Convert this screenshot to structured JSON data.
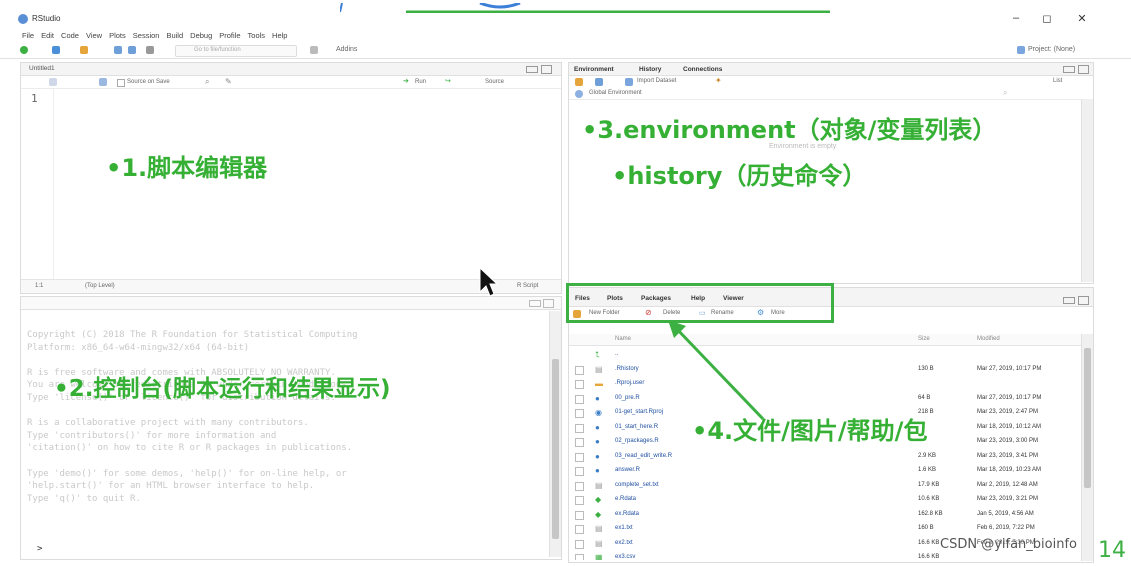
{
  "window": {
    "title": "RStudio",
    "controls": [
      "–",
      "◻",
      "✕"
    ]
  },
  "menu": [
    "File",
    "Edit",
    "Code",
    "View",
    "Plots",
    "Session",
    "Build",
    "Debug",
    "Profile",
    "Tools",
    "Help"
  ],
  "toolbar": {
    "goto_placeholder": "Go to file/function",
    "addins_label": "Addins",
    "project_label": "Project: (None)"
  },
  "editor": {
    "tab_label": "Untitled1",
    "source_on_save": "Source on Save",
    "run_label": "Run",
    "source_label": "Source",
    "line_number": "1",
    "status_pos": "1:1",
    "status_level": "(Top Level)",
    "status_type": "R Script"
  },
  "console": {
    "lines": [
      "Copyright (C) 2018 The R Foundation for Statistical Computing",
      "Platform: x86_64-w64-mingw32/x64 (64-bit)",
      "",
      "R is free software and comes with ABSOLUTELY NO WARRANTY.",
      "You are welcome to redistribute it under certain conditions.",
      "Type 'license()' or 'licence()' for distribution details.",
      "",
      "R is a collaborative project with many contributors.",
      "Type 'contributors()' for more information and",
      "'citation()' on how to cite R or R packages in publications.",
      "",
      "Type 'demo()' for some demos, 'help()' for on-line help, or",
      "'help.start()' for an HTML browser interface to help.",
      "Type 'q()' to quit R."
    ],
    "prompt": ">"
  },
  "environment": {
    "tabs": [
      "Environment",
      "History",
      "Connections"
    ],
    "import_dataset": "Import Dataset",
    "list_label": "List",
    "global_env": "Global Environment",
    "empty_text": "Environment is empty"
  },
  "files": {
    "tabs": [
      "Files",
      "Plots",
      "Packages",
      "Help",
      "Viewer"
    ],
    "buttons": [
      "New Folder",
      "Delete",
      "Rename",
      "More"
    ],
    "columns": [
      "Name",
      "Size",
      "Modified"
    ],
    "rows": [
      {
        "name": "..",
        "size": "",
        "modified": ""
      },
      {
        "name": ".Rhistory",
        "size": "130 B",
        "modified": "Mar 27, 2019, 10:17 PM"
      },
      {
        "name": ".Rproj.user",
        "size": "",
        "modified": ""
      },
      {
        "name": "00_pre.R",
        "size": "64 B",
        "modified": "Mar 27, 2019, 10:17 PM"
      },
      {
        "name": "01-get_start.Rproj",
        "size": "218 B",
        "modified": "Mar 23, 2019, 2:47 PM"
      },
      {
        "name": "01_start_here.R",
        "size": "",
        "modified": "Mar 18, 2019, 10:12 AM"
      },
      {
        "name": "02_rpackages.R",
        "size": "",
        "modified": "Mar 23, 2019, 3:00 PM"
      },
      {
        "name": "03_read_edit_write.R",
        "size": "2.9 KB",
        "modified": "Mar 23, 2019, 3:41 PM"
      },
      {
        "name": "answer.R",
        "size": "1.6 KB",
        "modified": "Mar 18, 2019, 10:23 AM"
      },
      {
        "name": "complete_set.txt",
        "size": "17.9 KB",
        "modified": "Mar 2, 2019, 12:48 AM"
      },
      {
        "name": "e.Rdata",
        "size": "10.6 KB",
        "modified": "Mar 23, 2019, 3:21 PM"
      },
      {
        "name": "ex.Rdata",
        "size": "162.8 KB",
        "modified": "Jan 5, 2019, 4:56 AM"
      },
      {
        "name": "ex1.txt",
        "size": "160 B",
        "modified": "Feb 6, 2019, 7:22 PM"
      },
      {
        "name": "ex2.txt",
        "size": "16.6 KB",
        "modified": "Feb 6, 2019, 7:30 PM"
      },
      {
        "name": "ex3.csv",
        "size": "16.6 KB",
        "modified": ""
      }
    ]
  },
  "annotations": {
    "editor": "•1.脚本编辑器",
    "console": "•2.控制台(脚本运行和结果显示)",
    "environment": "•3.environment（对象/变量列表）",
    "history": "•history（历史命令）",
    "files": "•4.文件/图片/帮助/包"
  },
  "watermark": "CSDN @yifan_bioinfo",
  "page_number": "14",
  "colors": {
    "annotation": "#35b035",
    "highlight_box": "#3cb043"
  }
}
